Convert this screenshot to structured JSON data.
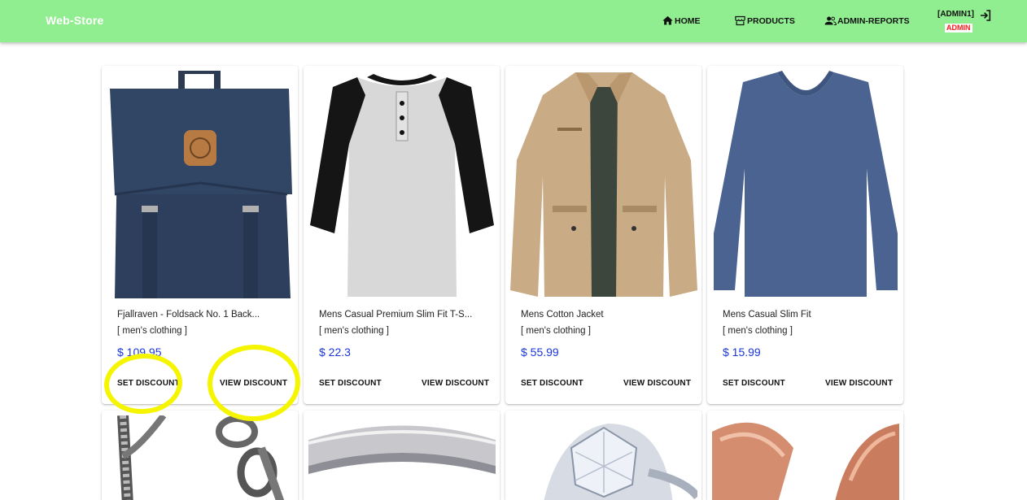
{
  "app": {
    "brand": "Web-Store"
  },
  "nav": {
    "home": "HOME",
    "products": "PRODUCTS",
    "reports": "ADMIN-REPORTS"
  },
  "user": {
    "name": "[ADMIN1]",
    "role": "ADMIN"
  },
  "products": [
    {
      "title": "Fjallraven - Foldsack No. 1 Back...",
      "category": "[ men's clothing ]",
      "price": "$ 109.95",
      "set_label": "SET DISCOUNT",
      "view_label": "VIEW DISCOUNT",
      "image": "backpack"
    },
    {
      "title": "Mens Casual Premium Slim Fit T-S...",
      "category": "[ men's clothing ]",
      "price": "$ 22.3",
      "set_label": "SET DISCOUNT",
      "view_label": "VIEW DISCOUNT",
      "image": "raglan-tshirt"
    },
    {
      "title": "Mens Cotton Jacket",
      "category": "[ men's clothing ]",
      "price": "$ 55.99",
      "set_label": "SET DISCOUNT",
      "view_label": "VIEW DISCOUNT",
      "image": "cotton-jacket"
    },
    {
      "title": "Mens Casual Slim Fit",
      "category": "[ men's clothing ]",
      "price": "$ 15.99",
      "set_label": "SET DISCOUNT",
      "view_label": "VIEW DISCOUNT",
      "image": "longsleeve-shirt"
    },
    {
      "image": "chain-bracelet"
    },
    {
      "image": "silver-ring"
    },
    {
      "image": "diamond-ring"
    },
    {
      "image": "rose-gold-earrings"
    }
  ],
  "colors": {
    "appbar": "#90ee90",
    "price": "#1a36d8",
    "role": "#ff1a1a",
    "highlight": "#f5f500"
  }
}
